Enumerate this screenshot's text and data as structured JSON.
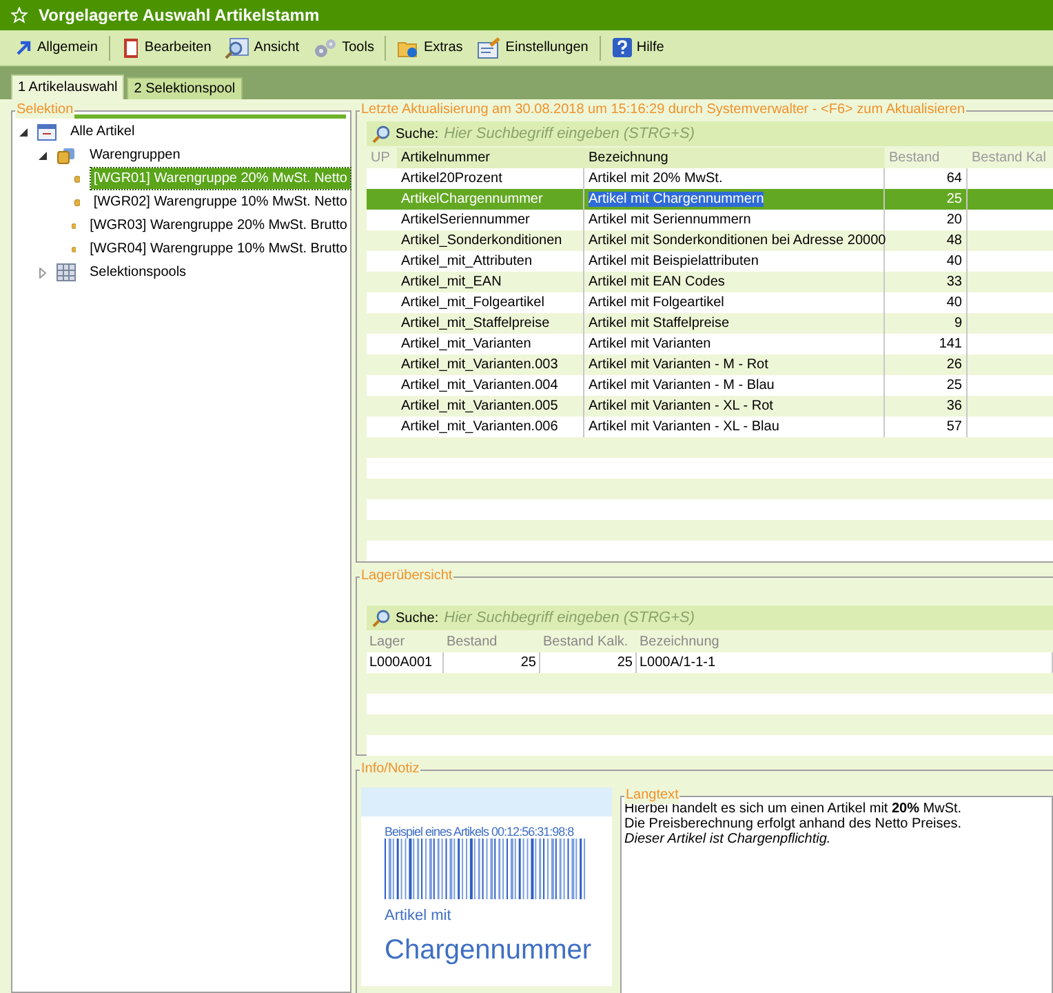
{
  "window": {
    "title": "Vorgelagerte Auswahl Artikelstamm"
  },
  "toolbar": [
    {
      "label": "Allgemein"
    },
    {
      "label": "Bearbeiten"
    },
    {
      "label": "Ansicht"
    },
    {
      "label": "Tools"
    },
    {
      "label": "Extras"
    },
    {
      "label": "Einstellungen"
    },
    {
      "label": "Hilfe"
    }
  ],
  "tabs": [
    {
      "label": "1 Artikelauswahl",
      "selected": true
    },
    {
      "label": "2 Selektionspool",
      "selected": false
    }
  ],
  "selection": {
    "title": "Selektion",
    "tree": [
      {
        "label": "Alle Artikel",
        "expanded": true,
        "selected": false,
        "children": [
          {
            "label": "Warengruppen",
            "expanded": true,
            "selected": false,
            "children": [
              {
                "label": "[WGR01] Warengruppe 20% MwSt. Netto",
                "selected": true
              },
              {
                "label": "[WGR02] Warengruppe 10% MwSt. Netto",
                "selected": false
              },
              {
                "label": "[WGR03] Warengruppe 20% MwSt. Brutto",
                "selected": false
              },
              {
                "label": "[WGR04] Warengruppe 10% MwSt. Brutto",
                "selected": false
              }
            ]
          },
          {
            "label": "Selektionspools",
            "expanded": false,
            "selected": false
          }
        ]
      }
    ]
  },
  "articles": {
    "title": "Letzte Aktualisierung am 30.08.2018 um 15:16:29 durch Systemverwalter - <F6> zum Aktualisieren",
    "search_label": "Suche:",
    "search_placeholder": "Hier Suchbegriff eingeben (STRG+S)",
    "columns": [
      "UP",
      "Artikelnummer",
      "Bezeichnung",
      "Bestand",
      "Bestand Kal"
    ],
    "rows": [
      {
        "number": "Artikel20Prozent",
        "name": "Artikel mit 20% MwSt.",
        "stock": "64",
        "selected": false
      },
      {
        "number": "ArtikelChargennummer",
        "name": "Artikel mit Chargennummern",
        "stock": "25",
        "selected": true
      },
      {
        "number": "ArtikelSeriennummer",
        "name": "Artikel mit Seriennummern",
        "stock": "20",
        "selected": false
      },
      {
        "number": "Artikel_Sonderkonditionen",
        "name": "Artikel mit Sonderkonditionen bei Adresse 20000",
        "stock": "48",
        "selected": false
      },
      {
        "number": "Artikel_mit_Attributen",
        "name": "Artikel mit Beispielattributen",
        "stock": "40",
        "selected": false
      },
      {
        "number": "Artikel_mit_EAN",
        "name": "Artikel mit EAN Codes",
        "stock": "33",
        "selected": false
      },
      {
        "number": "Artikel_mit_Folgeartikel",
        "name": "Artikel mit Folgeartikel",
        "stock": "40",
        "selected": false
      },
      {
        "number": "Artikel_mit_Staffelpreise",
        "name": "Artikel mit Staffelpreise",
        "stock": "9",
        "selected": false
      },
      {
        "number": "Artikel_mit_Varianten",
        "name": "Artikel mit Varianten",
        "stock": "141",
        "selected": false
      },
      {
        "number": "Artikel_mit_Varianten.003",
        "name": "Artikel mit Varianten - M - Rot",
        "stock": "26",
        "selected": false
      },
      {
        "number": "Artikel_mit_Varianten.004",
        "name": "Artikel mit Varianten - M - Blau",
        "stock": "25",
        "selected": false
      },
      {
        "number": "Artikel_mit_Varianten.005",
        "name": "Artikel mit Varianten - XL - Rot",
        "stock": "36",
        "selected": false
      },
      {
        "number": "Artikel_mit_Varianten.006",
        "name": "Artikel mit Varianten - XL - Blau",
        "stock": "57",
        "selected": false
      }
    ]
  },
  "storage": {
    "title": "Lagerübersicht",
    "search_label": "Suche:",
    "search_placeholder": "Hier Suchbegriff eingeben (STRG+S)",
    "columns": [
      "Lager",
      "Bestand",
      "Bestand Kalk.",
      "Bezeichnung"
    ],
    "rows": [
      {
        "cells": [
          "L000A001",
          "25",
          "25",
          "L000A/1-1-1"
        ]
      }
    ]
  },
  "info": {
    "title": "Info/Notiz",
    "label": {
      "caption": "Beispiel eines Artikels 00:12:56:31:98:8",
      "line_1": "Artikel mit",
      "line_2": "Chargennummer"
    },
    "longtext": {
      "title": "Langtext",
      "lines": [
        {
          "text": "Hierbei handelt es sich um einen Artikel mit **20%** MwSt.",
          "kind": "normal"
        },
        {
          "text": "Die Preisberechnung erfolgt anhand des Netto Preises.",
          "kind": "normal"
        },
        {
          "text": "Dieser Artikel ist Chargenpflichtig.",
          "kind": "italic"
        }
      ]
    }
  }
}
